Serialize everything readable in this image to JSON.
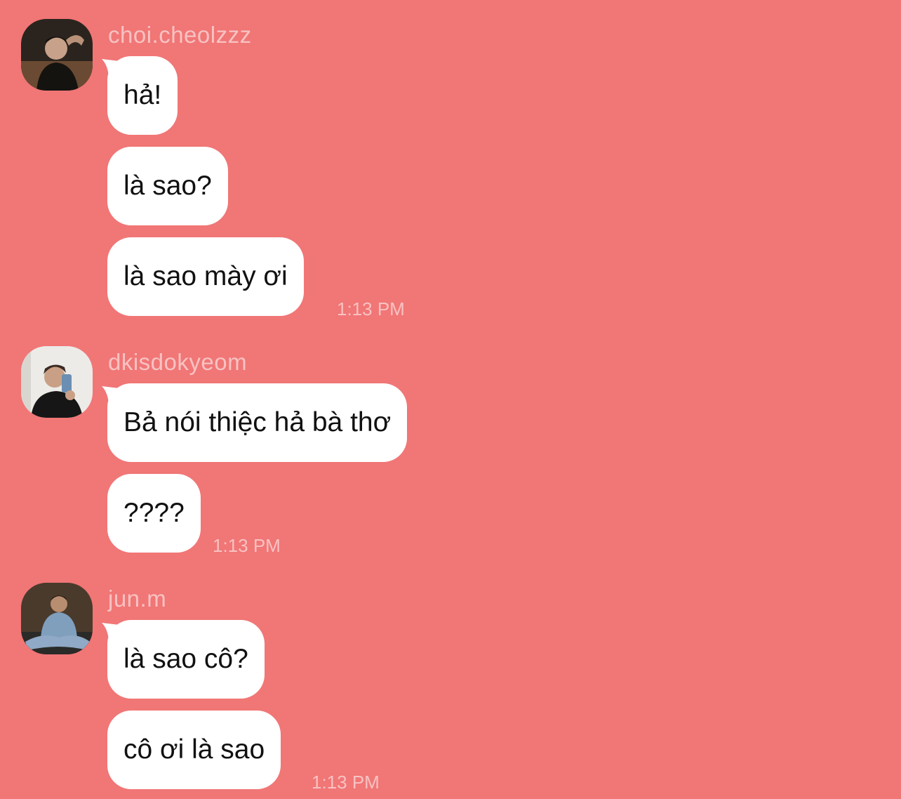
{
  "conversation": {
    "groups": [
      {
        "sender": "choi.cheolzzz",
        "avatar_icon": "user-photo-dark-hair",
        "messages": [
          "hả!",
          "là sao?",
          "là sao mày ơi"
        ],
        "time": "1:13 PM"
      },
      {
        "sender": "dkisdokyeom",
        "avatar_icon": "user-photo-selfie",
        "messages": [
          "Bả nói thiệc hả bà thơ",
          "????"
        ],
        "time": "1:13 PM"
      },
      {
        "sender": "jun.m",
        "avatar_icon": "user-photo-denim",
        "messages": [
          "là sao cô?",
          "cô ơi là sao"
        ],
        "time": "1:13 PM"
      }
    ]
  },
  "colors": {
    "background": "#F17676",
    "bubble": "#FFFFFF",
    "muted_text": "#F8C2C2",
    "message_text": "#111111"
  }
}
